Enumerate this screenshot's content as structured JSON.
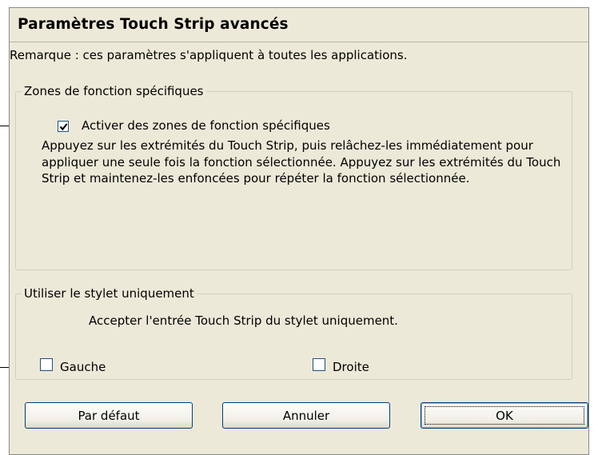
{
  "dialog": {
    "title": "Paramètres Touch Strip avancés",
    "note": "Remarque : ces paramètres s'appliquent à toutes les applications."
  },
  "function_zones": {
    "legend": "Zones de fonction spécifiques",
    "checkbox_label": "Activer des zones de fonction spécifiques",
    "checked": true,
    "description": "Appuyez sur les extrémités du Touch Strip, puis relâchez-les immédiatement pour appliquer une seule fois la fonction sélectionnée. Appuyez sur les extrémités du Touch Strip et maintenez-les enfoncées pour répéter la fonction sélectionnée."
  },
  "pen_only": {
    "legend": "Utiliser le stylet uniquement",
    "text": "Accepter l'entrée Touch Strip du stylet uniquement.",
    "left_label": "Gauche",
    "left_checked": false,
    "right_label": "Droite",
    "right_checked": false
  },
  "buttons": {
    "default": "Par défaut",
    "cancel": "Annuler",
    "ok": "OK"
  }
}
